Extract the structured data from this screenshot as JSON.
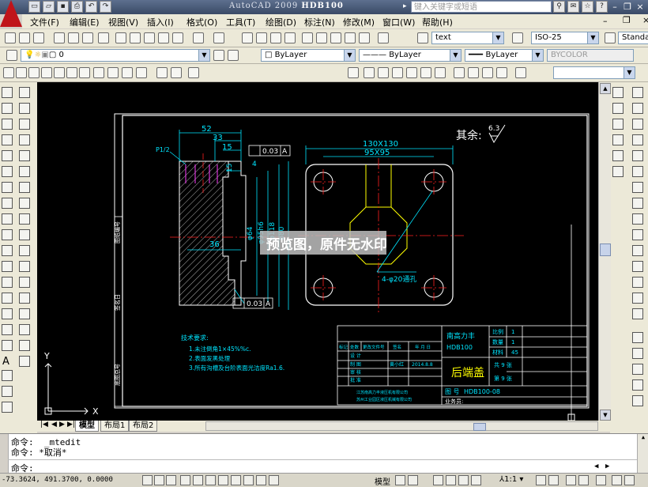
{
  "window": {
    "title_prefix": "AutoCAD 2009",
    "title_file": "HDB100",
    "search_placeholder": "键入关键字或短语"
  },
  "menus": [
    "文件(F)",
    "编辑(E)",
    "视图(V)",
    "插入(I)",
    "格式(O)",
    "工具(T)",
    "绘图(D)",
    "标注(N)",
    "修改(M)",
    "窗口(W)",
    "帮助(H)"
  ],
  "toolbar": {
    "text_style": "text",
    "dim_style": "ISO-25",
    "table_style": "Standar",
    "layer": "0",
    "color": "ByLayer",
    "linetype": "ByLayer",
    "lineweight": "ByLayer",
    "plotstyle": "BYCOLOR"
  },
  "drawing": {
    "watermark": "预览图，原件无水印",
    "roughness_label": "其余:",
    "roughness_value": "6.3",
    "dims": {
      "d52": "52",
      "d33": "33",
      "d15": "15",
      "d15b": "15",
      "d4": "4",
      "d36": "36",
      "phi64": "φ64",
      "phi95": "φ95h6",
      "phi118": "φ118",
      "phi80": "φ80",
      "w130": "130X130",
      "w95": "95X95",
      "holes": "4-φ20通孔",
      "pipe": "P1/2",
      "tol1": "0.03",
      "tol1_ref": "A",
      "tol2": "0.03",
      "tol2_ref": "A",
      "datum": "A"
    },
    "notes_title": "技术要求:",
    "notes": [
      "1.未注倒角1×45%%c.",
      "2.表面发黑处理",
      "3.所有沟槽及台阶表面光洁度Ra1.6."
    ],
    "titleblock": {
      "company_name": "南高力丰",
      "drawing_code": "HDB100",
      "part_name": "后端盖",
      "scale_label": "比例",
      "scale_value": "1",
      "qty_label": "数量",
      "qty_value": "1",
      "material_label": "材料",
      "material_value": "45",
      "sheets_total": "共 9 张",
      "sheet_no": "第 9 张",
      "drawing_no_label": "图  号",
      "drawing_no": "HDB100-08",
      "row_headers": [
        "标记",
        "处数",
        "更改文件号",
        "签名",
        "年 月 日"
      ],
      "row_designer": "设 计",
      "row_checker": "制 图",
      "row_checker_name": "黄小红",
      "row_date": "2014.8.8",
      "row_review": "审 核",
      "row_approve": "批 准",
      "company_line1": "江苏南高力丰液压机有限公司",
      "company_line2": "苏州工业园区液压机械有限公司",
      "business_no": "业务员:"
    },
    "left_strip_labels": [
      "图纸编号",
      "签名日",
      "底图总号"
    ],
    "axis_x": "X",
    "axis_y": "Y"
  },
  "tabs": [
    "模型",
    "布局1",
    "布局2"
  ],
  "command": {
    "line1_label": "命令:",
    "line1_value": "_mtedit",
    "line2_label": "命令:",
    "line2_value": "*取消*",
    "prompt": "命令:"
  },
  "status": {
    "coords": "-73.3624,  491.3700, 0.0000",
    "model_label": "模型",
    "annotation_scale": "1:1"
  }
}
